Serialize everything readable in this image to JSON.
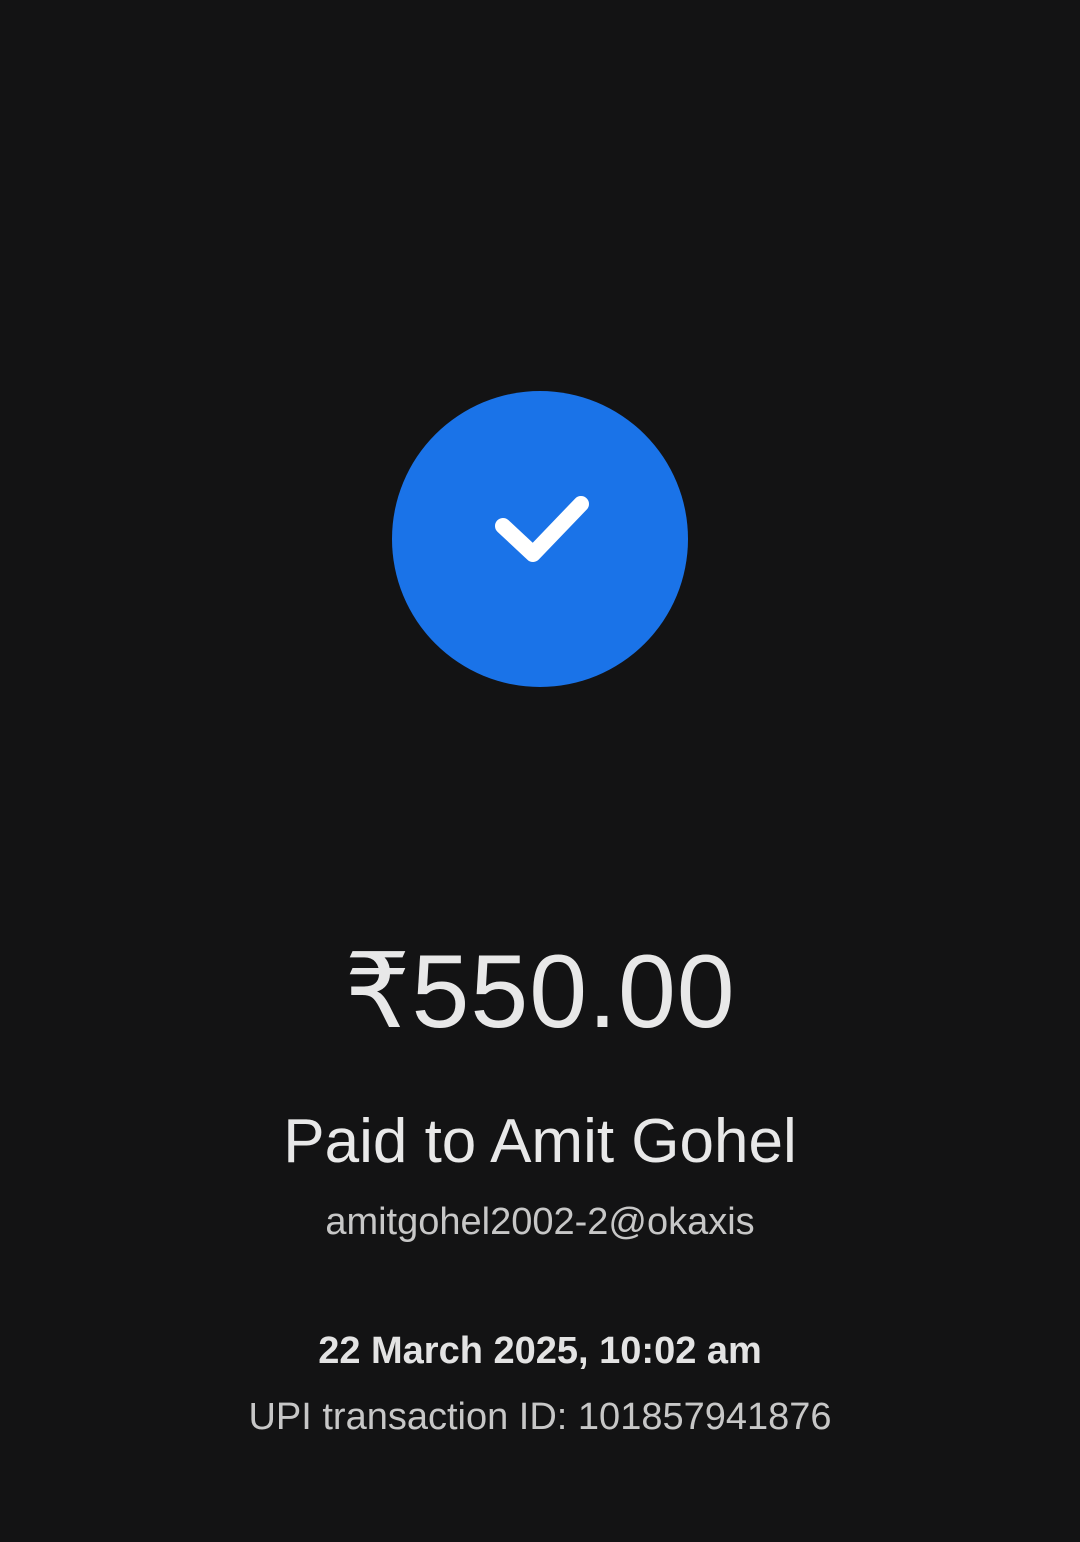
{
  "status": {
    "icon": "check-icon",
    "accent_color": "#1a73e8"
  },
  "payment": {
    "amount": "₹550.00",
    "paid_to": "Paid to Amit Gohel",
    "upi_id": "amitgohel2002-2@okaxis",
    "datetime": "22 March 2025, 10:02 am",
    "transaction_id": "UPI transaction ID: 101857941876"
  }
}
